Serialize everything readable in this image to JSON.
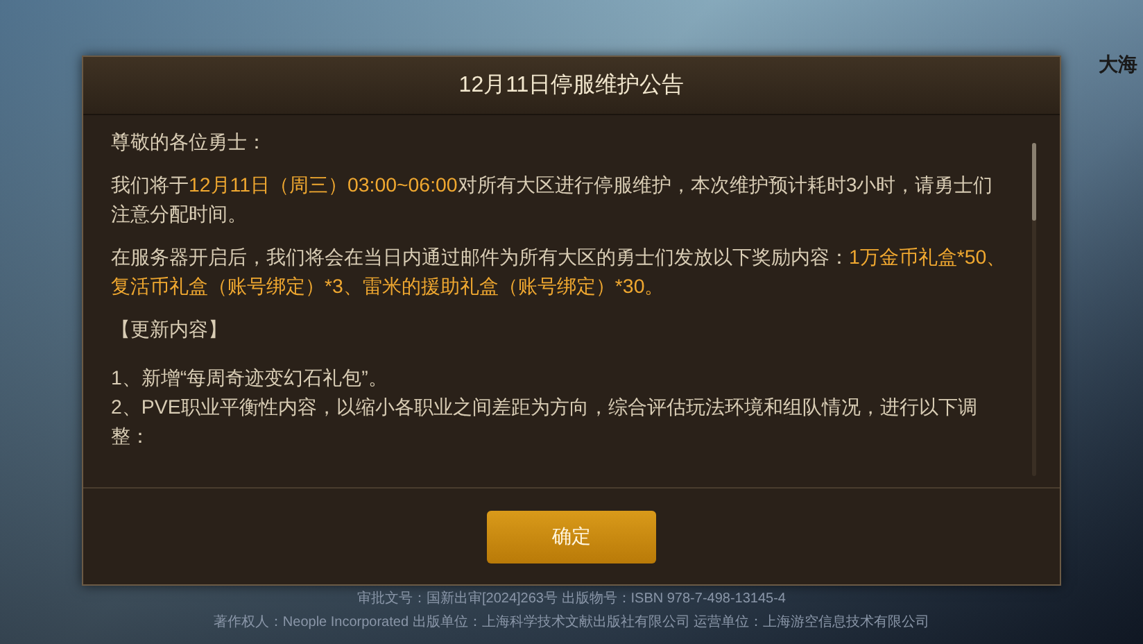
{
  "background": {
    "corner_text": "大海",
    "footer": [
      "审批文号：国新出审[2024]263号 出版物号：ISBN 978-7-498-13145-4",
      "著作权人：Neople Incorporated 出版单位：上海科学技术文献出版社有限公司 运营单位：上海游空信息技术有限公司"
    ]
  },
  "dialog": {
    "title": "12月11日停服维护公告",
    "content": [
      {
        "kind": "para",
        "segments": [
          {
            "text": "尊敬的各位勇士：",
            "highlight": false
          }
        ]
      },
      {
        "kind": "para",
        "segments": [
          {
            "text": "我们将于",
            "highlight": false
          },
          {
            "text": "12月11日（周三）03:00~06:00",
            "highlight": true
          },
          {
            "text": "对所有大区进行停服维护，本次维护预计耗时3小时，请勇士们注意分配时间。",
            "highlight": false
          }
        ]
      },
      {
        "kind": "para",
        "segments": [
          {
            "text": "在服务器开启后，我们将会在当日内通过邮件为所有大区的勇士们发放以下奖励内容：",
            "highlight": false
          },
          {
            "text": "1万金币礼盒*50、复活币礼盒（账号绑定）*3、雷米的援助礼盒（账号绑定）*30。",
            "highlight": true
          }
        ]
      },
      {
        "kind": "para",
        "segments": [
          {
            "text": "【更新内容】",
            "highlight": false
          }
        ]
      },
      {
        "kind": "item",
        "segments": [
          {
            "text": "1、新增“每周奇迹变幻石礼包”。",
            "highlight": false
          }
        ]
      },
      {
        "kind": "item",
        "segments": [
          {
            "text": "2、PVE职业平衡性内容，以缩小各职业之间差距为方向，综合评估玩法环境和组队情况，进行以下调整：",
            "highlight": false
          }
        ]
      }
    ],
    "button": "确定"
  }
}
